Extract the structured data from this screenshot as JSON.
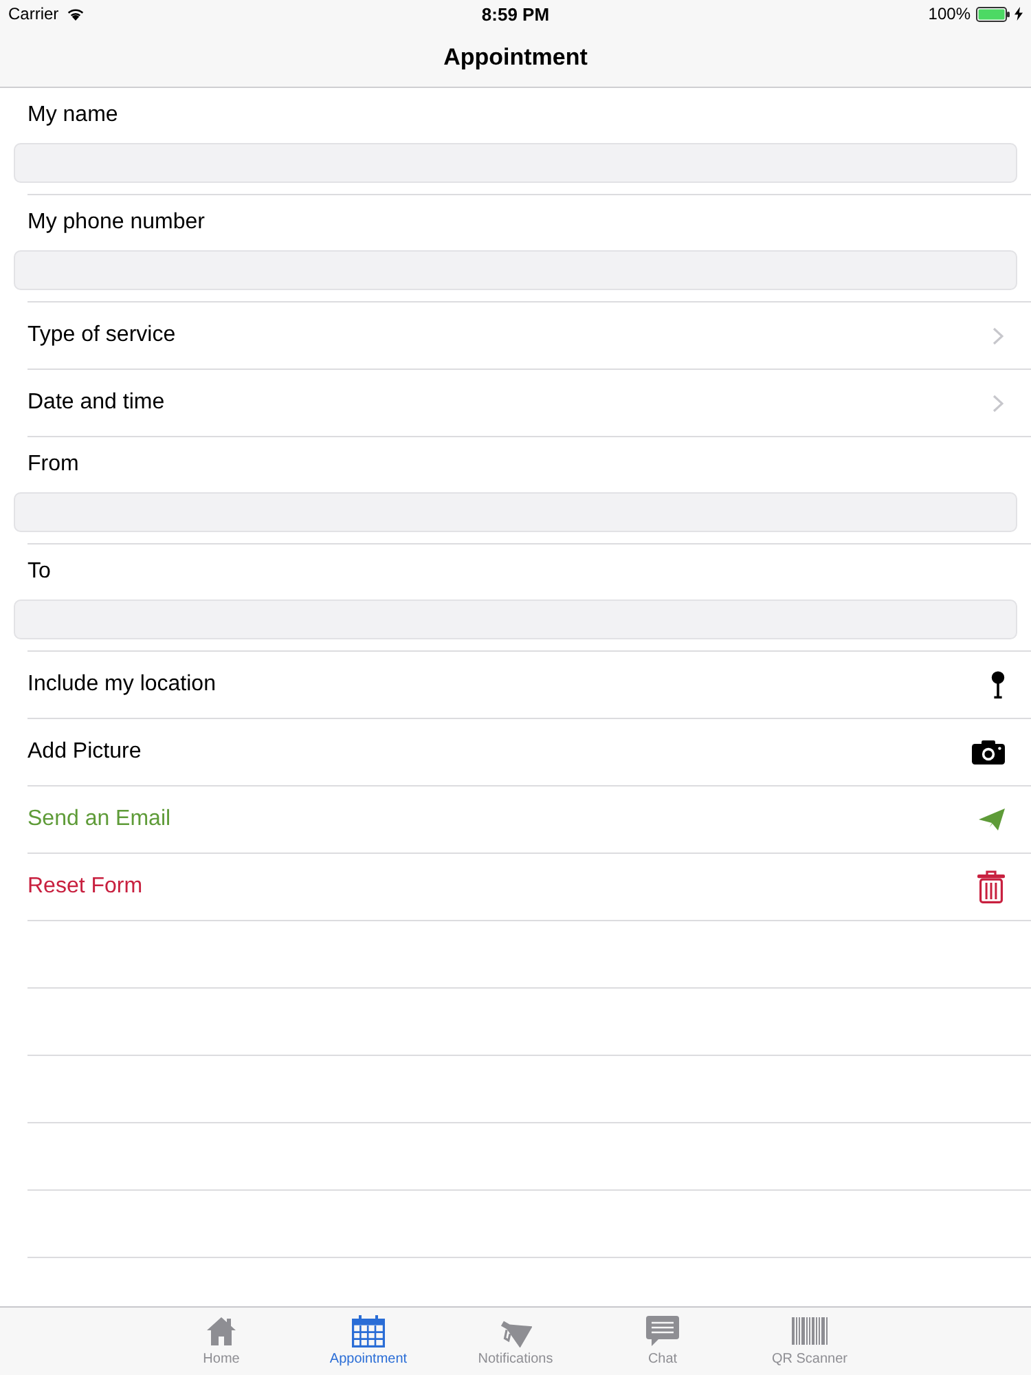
{
  "status_bar": {
    "carrier": "Carrier",
    "time": "8:59 PM",
    "battery": "100%"
  },
  "nav_bar": {
    "title": "Appointment"
  },
  "form": [
    {
      "kind": "field",
      "label": "My name"
    },
    {
      "kind": "field",
      "label": "My phone number"
    },
    {
      "kind": "disclosure",
      "label": "Type of service"
    },
    {
      "kind": "disclosure",
      "label": "Date and time"
    },
    {
      "kind": "field",
      "label": "From"
    },
    {
      "kind": "field",
      "label": "To"
    },
    {
      "kind": "location",
      "label": "Include my location",
      "color": "#000000"
    },
    {
      "kind": "picture",
      "label": "Add Picture",
      "color": "#000000"
    },
    {
      "kind": "email",
      "label": "Send an Email",
      "color": "#5e9b38"
    },
    {
      "kind": "reset",
      "label": "Reset Form",
      "color": "#c8203f"
    }
  ],
  "tab_bar": {
    "tabs": [
      {
        "label": "Home",
        "selected": false
      },
      {
        "label": "Appointment",
        "selected": true
      },
      {
        "label": "Notifications",
        "selected": false
      },
      {
        "label": "Chat",
        "selected": false
      },
      {
        "label": "QR Scanner",
        "selected": false
      }
    ]
  }
}
